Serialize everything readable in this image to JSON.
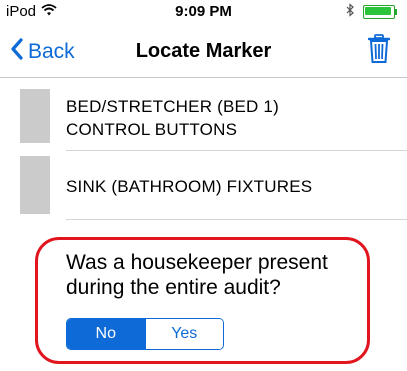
{
  "status_bar": {
    "carrier": "iPod",
    "time": "9:09 PM"
  },
  "nav": {
    "back_label": "Back",
    "title": "Locate Marker"
  },
  "markers": [
    {
      "label_line1": "BED/STRETCHER (BED 1)",
      "label_line2": "CONTROL BUTTONS"
    },
    {
      "label_line1": "SINK (BATHROOM) FIXTURES"
    }
  ],
  "question": {
    "line1": "Was a housekeeper present",
    "line2": "during the entire audit?",
    "options": [
      "No",
      "Yes"
    ],
    "selected": "No"
  },
  "colors": {
    "accent": "#0e6ad6",
    "highlight_border": "#e0151e",
    "thumbnail": "#cbcbcb",
    "battery": "#2cc43a"
  },
  "icons": {
    "wifi": "wifi-icon",
    "bluetooth": "bluetooth-icon",
    "battery": "battery-icon",
    "back": "chevron-left-icon",
    "trash": "trash-icon"
  }
}
